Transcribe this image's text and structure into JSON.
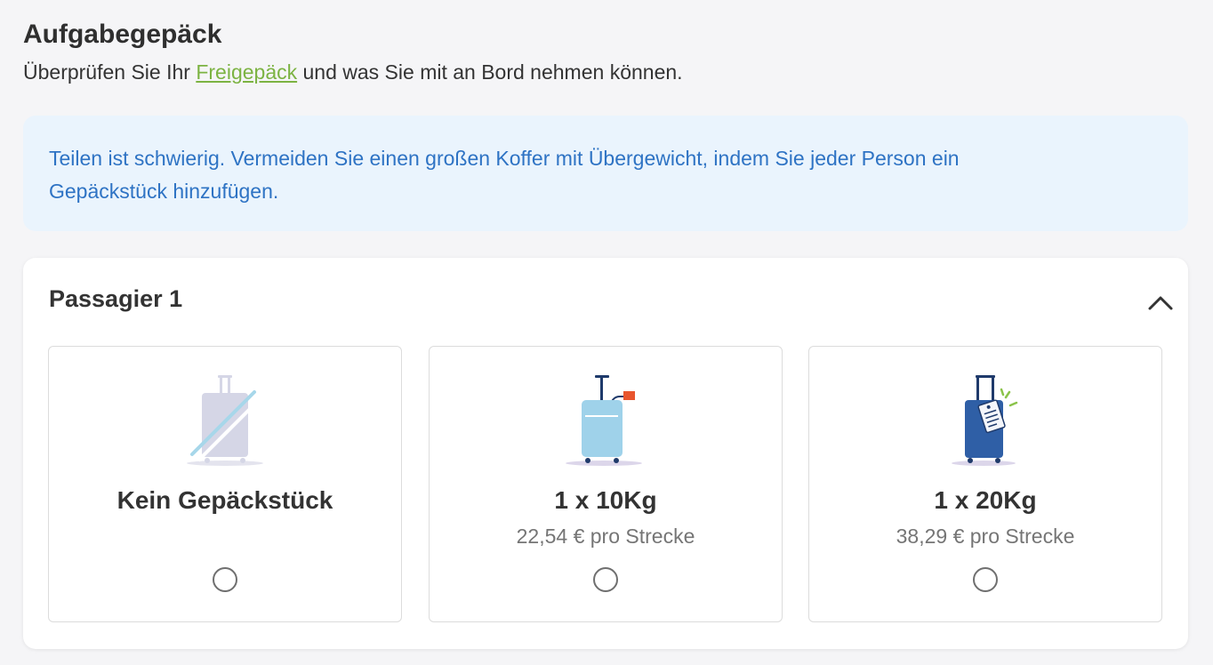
{
  "header": {
    "title": "Aufgabegepäck",
    "subtitle_before": "Überprüfen Sie Ihr ",
    "subtitle_link": "Freigepäck",
    "subtitle_after": " und was Sie mit an Bord nehmen können."
  },
  "info": {
    "text": "Teilen ist schwierig. Vermeiden Sie einen großen Koffer mit Übergewicht, indem Sie jeder Person ein Gepäckstück hinzufügen."
  },
  "passenger": {
    "title": "Passagier 1",
    "collapse_icon": "chevron-up-icon",
    "options": [
      {
        "label": "Kein Gepäckstück",
        "price": "",
        "icon": "no-luggage-icon",
        "selected": false
      },
      {
        "label": "1 x 10Kg",
        "price": "22,54 € pro Strecke",
        "icon": "suitcase-10kg-icon",
        "selected": false
      },
      {
        "label": "1 x 20Kg",
        "price": "38,29 € pro Strecke",
        "icon": "suitcase-20kg-icon",
        "selected": false
      }
    ]
  },
  "colors": {
    "link": "#7cb342",
    "info_text": "#2e73c4",
    "info_background": "#eaf4fd"
  }
}
